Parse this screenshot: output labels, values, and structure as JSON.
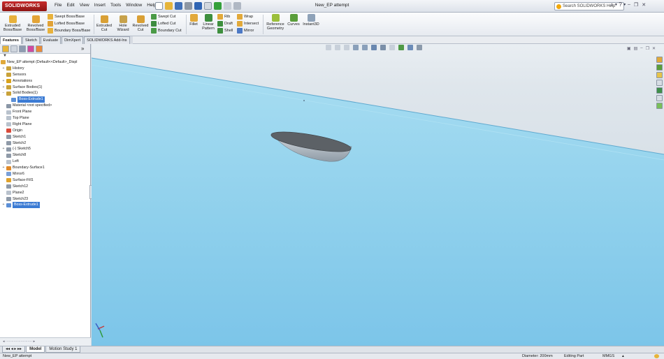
{
  "app": {
    "logo_text": "SOLIDWORKS",
    "document_title": "New_EP attempt",
    "menus": [
      "File",
      "Edit",
      "View",
      "Insert",
      "Tools",
      "Window",
      "Help"
    ],
    "search_placeholder": "Search SOLIDWORKS Help",
    "search_button": "⌕ ▾  ? ▾"
  },
  "ribbon": {
    "extruded_boss": "Extruded Boss/Base",
    "revolved_boss": "Revolved Boss/Base",
    "swept_boss": "Swept Boss/Base",
    "lofted_boss": "Lofted Boss/Base",
    "boundary_boss": "Boundary Boss/Base",
    "extruded_cut": "Extruded Cut",
    "hole_wizard": "Hole Wizard",
    "revolved_cut": "Revolved Cut",
    "swept_cut": "Swept Cut",
    "lofted_cut": "Lofted Cut",
    "boundary_cut": "Boundary Cut",
    "fillet": "Fillet",
    "linear_pattern": "Linear Pattern",
    "rib": "Rib",
    "draft": "Draft",
    "shell": "Shell",
    "wrap": "Wrap",
    "intersect": "Intersect",
    "mirror": "Mirror",
    "reference_geometry": "Reference Geometry",
    "curves": "Curves",
    "instant3d": "Instant3D"
  },
  "command_tabs": [
    "Features",
    "Sketch",
    "Evaluate",
    "DimXpert",
    "SOLIDWORKS Add-Ins"
  ],
  "feature_tree": {
    "filter_icon": "funnel-icon",
    "root": "New_EP attempt  (Default<<Default>_Displ",
    "items": [
      {
        "label": "History",
        "icon": "history-icon",
        "exp": "+",
        "indent": 1,
        "color": "#c9a23a"
      },
      {
        "label": "Sensors",
        "icon": "sensor-icon",
        "exp": "",
        "indent": 1,
        "color": "#c9a23a"
      },
      {
        "label": "Annotations",
        "icon": "annotation-icon",
        "exp": "+",
        "indent": 1,
        "color": "#d9a21a"
      },
      {
        "label": "Surface Bodies(1)",
        "icon": "surface-bodies-icon",
        "exp": "+",
        "indent": 1,
        "color": "#c9a23a"
      },
      {
        "label": "Solid Bodies(1)",
        "icon": "solid-bodies-icon",
        "exp": "−",
        "indent": 1,
        "color": "#c9a23a"
      },
      {
        "label": "Boss-Extrude1",
        "icon": "body-icon",
        "exp": "",
        "indent": 2,
        "color": "#5b8fd6",
        "selected": true
      },
      {
        "label": "Material <not specified>",
        "icon": "material-icon",
        "exp": "",
        "indent": 1,
        "color": "#8a96a6"
      },
      {
        "label": "Front Plane",
        "icon": "plane-icon",
        "exp": "",
        "indent": 1,
        "color": "#b9c2cd"
      },
      {
        "label": "Top Plane",
        "icon": "plane-icon",
        "exp": "",
        "indent": 1,
        "color": "#b9c2cd"
      },
      {
        "label": "Right Plane",
        "icon": "plane-icon",
        "exp": "",
        "indent": 1,
        "color": "#b9c2cd"
      },
      {
        "label": "Origin",
        "icon": "origin-icon",
        "exp": "",
        "indent": 1,
        "color": "#d94a3a"
      },
      {
        "label": "Sketch1",
        "icon": "sketch-icon",
        "exp": "",
        "indent": 1,
        "color": "#8f9aa8"
      },
      {
        "label": "Sketch2",
        "icon": "sketch-icon",
        "exp": "",
        "indent": 1,
        "color": "#8f9aa8"
      },
      {
        "label": "(-) Sketch5",
        "icon": "sketch-icon",
        "exp": "+",
        "indent": 1,
        "color": "#8f9aa8"
      },
      {
        "label": "Sketch8",
        "icon": "sketch-icon",
        "exp": "",
        "indent": 1,
        "color": "#8f9aa8"
      },
      {
        "label": "Left",
        "icon": "plane-icon",
        "exp": "",
        "indent": 1,
        "color": "#b9c2cd"
      },
      {
        "label": "Boundary-Surface1",
        "icon": "boundary-surface-icon",
        "exp": "+",
        "indent": 1,
        "color": "#e08a2a"
      },
      {
        "label": "Mirror6",
        "icon": "mirror-icon",
        "exp": "",
        "indent": 1,
        "color": "#7aa0d8"
      },
      {
        "label": "Surface-Fill1",
        "icon": "surface-fill-icon",
        "exp": "",
        "indent": 1,
        "color": "#e0a22a"
      },
      {
        "label": "Sketch12",
        "icon": "sketch-icon",
        "exp": "",
        "indent": 1,
        "color": "#8f9aa8"
      },
      {
        "label": "Plane2",
        "icon": "plane-icon",
        "exp": "",
        "indent": 1,
        "color": "#b9c2cd"
      },
      {
        "label": "Sketch23",
        "icon": "sketch-icon",
        "exp": "",
        "indent": 1,
        "color": "#8f9aa8"
      },
      {
        "label": "Boss-Extrude1",
        "icon": "extrude-icon",
        "exp": "+",
        "indent": 1,
        "color": "#5b8fd6",
        "selected": true
      }
    ]
  },
  "bottom_tabs": [
    "Model",
    "Motion Study 1"
  ],
  "status": {
    "left": "New_EP attempt",
    "diameter": "Diameter: 200mm",
    "mode": "Editing Part",
    "units": "MMGS",
    "units_arrow": "▴"
  },
  "colors": {
    "water": "#9fd8ef",
    "water_deep": "#6fbfe6",
    "boat_top": "#5e6266",
    "boat_hull": "#b8c4cc",
    "selection": "#3b7bd4"
  }
}
